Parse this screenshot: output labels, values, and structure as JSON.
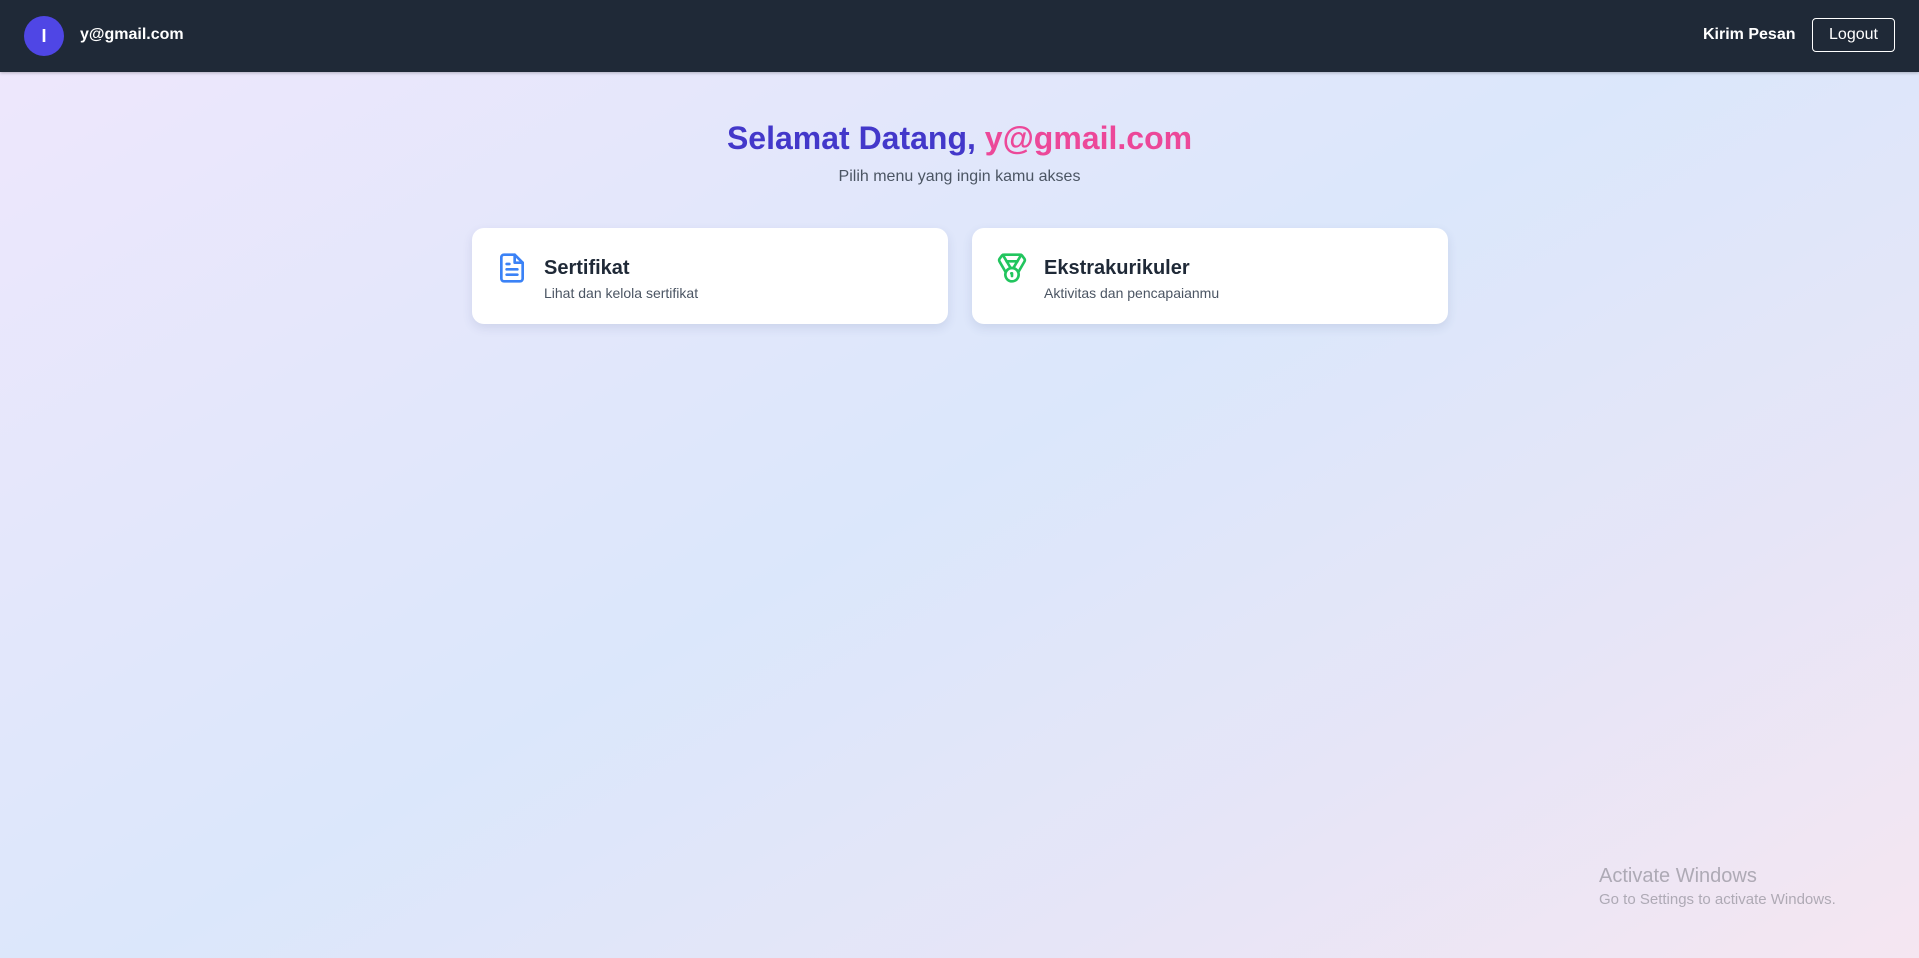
{
  "navbar": {
    "avatar_letter": "I",
    "user_email": "y@gmail.com",
    "send_message_label": "Kirim Pesan",
    "logout_label": "Logout"
  },
  "welcome": {
    "greeting": "Selamat Datang,",
    "user_name": "y@gmail.com",
    "subtitle": "Pilih menu yang ingin kamu akses"
  },
  "cards": [
    {
      "title": "Sertifikat",
      "description": "Lihat dan kelola sertifikat",
      "icon": "document-icon",
      "icon_color": "#3b82f6"
    },
    {
      "title": "Ekstrakurikuler",
      "description": "Aktivitas dan pencapaianmu",
      "icon": "medal-icon",
      "icon_color": "#22c55e"
    }
  ],
  "watermark": {
    "title": "Activate Windows",
    "subtitle": "Go to Settings to activate Windows."
  },
  "colors": {
    "navbar_bg": "#1f2937",
    "avatar_bg": "#4f46e5",
    "greeting": "#4338ca",
    "user_name": "#ec4899"
  }
}
